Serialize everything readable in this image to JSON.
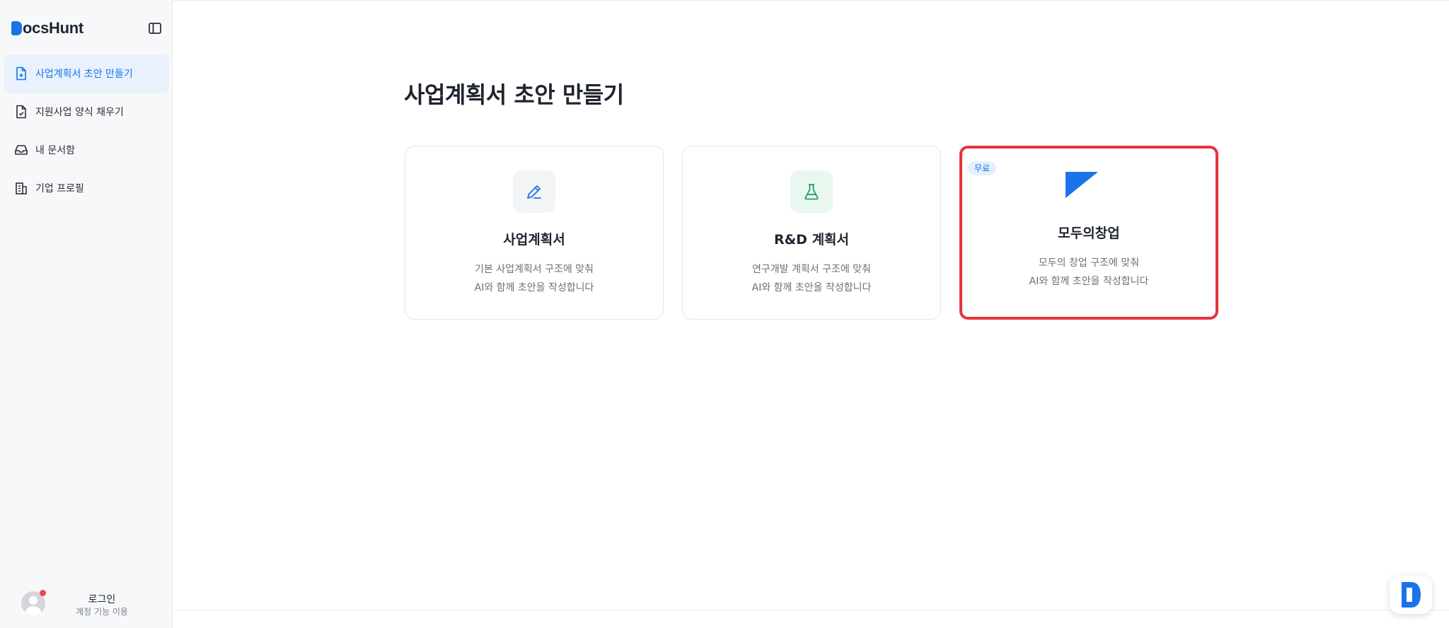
{
  "app": {
    "brand_rest": "ocsHunt"
  },
  "sidebar": {
    "items": [
      {
        "label": "사업계획서 초안 만들기",
        "icon": "file-plus-icon",
        "active": true
      },
      {
        "label": "지원사업 양식 채우기",
        "icon": "file-check-icon",
        "active": false
      },
      {
        "label": "내 문서함",
        "icon": "inbox-icon",
        "active": false
      },
      {
        "label": "기업 프로필",
        "icon": "building-icon",
        "active": false
      }
    ],
    "user": {
      "title": "로그인",
      "subtitle": "계정 기능 이용"
    }
  },
  "main": {
    "title": "사업계획서 초안 만들기",
    "cards": [
      {
        "title": "사업계획서",
        "desc1": "기본 사업계획서 구조에 맞춰",
        "desc2": "AI와 함께 초안을 작성합니다",
        "icon": "pencil-icon"
      },
      {
        "title": "R&D 계획서",
        "desc1": "연구개발 계획서 구조에 맞춰",
        "desc2": "AI와 함께 초안을 작성합니다",
        "icon": "flask-icon"
      },
      {
        "title": "모두의창업",
        "desc1": "모두의 창업 구조에 맞춰",
        "desc2": "AI와 함께 초안을 작성합니다",
        "icon": "flag-triangle-icon",
        "badge": "무료"
      }
    ]
  },
  "colors": {
    "accent": "#1a73e8",
    "highlight": "#e8333a",
    "green": "#1e9e5a"
  }
}
